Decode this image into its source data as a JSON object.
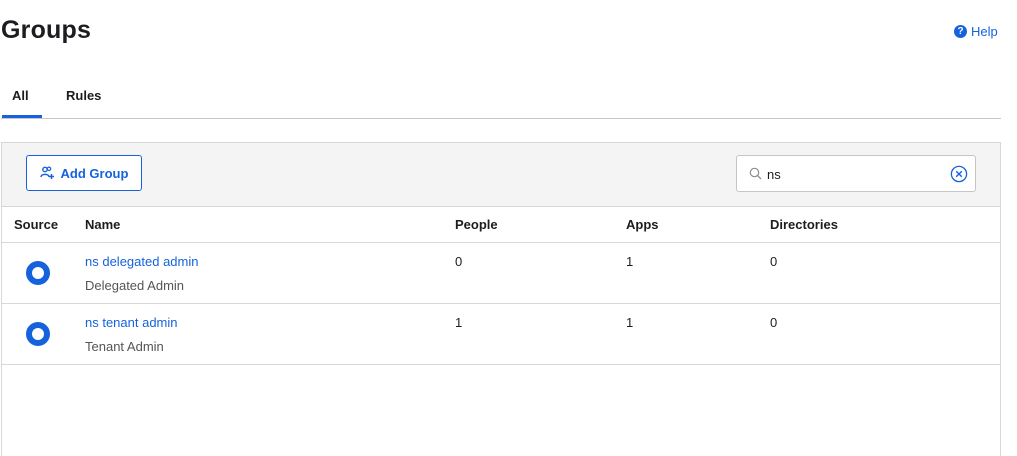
{
  "header": {
    "title": "Groups",
    "help_label": "Help",
    "help_icon": "question-circle-icon"
  },
  "tabs": [
    {
      "label": "All",
      "active": true
    },
    {
      "label": "Rules",
      "active": false
    }
  ],
  "toolbar": {
    "add_group_label": "Add Group",
    "add_group_icon": "add-group-icon",
    "search": {
      "value": "ns",
      "placeholder": "",
      "icon": "search-icon",
      "clear_icon": "clear-circle-icon"
    }
  },
  "table": {
    "columns": [
      "Source",
      "Name",
      "People",
      "Apps",
      "Directories"
    ],
    "rows": [
      {
        "source_icon": "okta-source-icon",
        "name": "ns delegated admin",
        "description": "Delegated Admin",
        "people": "0",
        "apps": "1",
        "directories": "0"
      },
      {
        "source_icon": "okta-source-icon",
        "name": "ns tenant admin",
        "description": "Tenant Admin",
        "people": "1",
        "apps": "1",
        "directories": "0"
      }
    ]
  },
  "colors": {
    "accent": "#1662dd",
    "text": "#1d1d21",
    "muted_text": "#555559",
    "toolbar_bg": "#f4f4f4",
    "border": "#d7d7dc"
  }
}
